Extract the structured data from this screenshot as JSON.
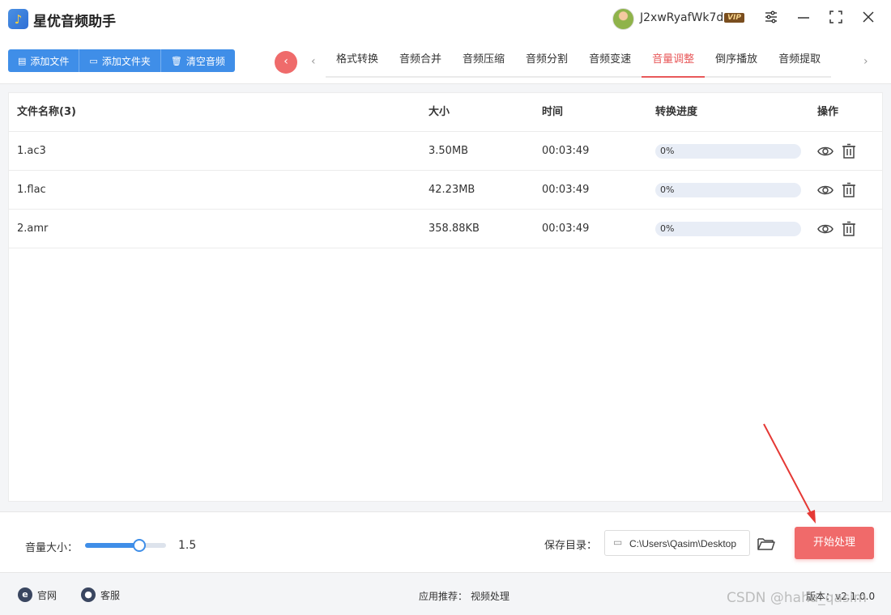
{
  "app": {
    "title": "星优音频助手",
    "logo_icon": "music-note-icon"
  },
  "user": {
    "name": "J2xwRyafWk7d",
    "badge": "VIP"
  },
  "toolbar": {
    "add_file": "添加文件",
    "add_folder": "添加文件夹",
    "clear_audio": "清空音频"
  },
  "tabs": [
    {
      "label": "格式转换",
      "active": false
    },
    {
      "label": "音频合并",
      "active": false
    },
    {
      "label": "音频压缩",
      "active": false
    },
    {
      "label": "音频分割",
      "active": false
    },
    {
      "label": "音频变速",
      "active": false
    },
    {
      "label": "音量调整",
      "active": true
    },
    {
      "label": "倒序播放",
      "active": false
    },
    {
      "label": "音频提取",
      "active": false
    }
  ],
  "table": {
    "headers": {
      "name": "文件名称(3)",
      "size": "大小",
      "time": "时间",
      "progress": "转换进度",
      "ops": "操作"
    },
    "rows": [
      {
        "name": "1.ac3",
        "size": "3.50MB",
        "time": "00:03:49",
        "progress": "0%",
        "progress_value": 0
      },
      {
        "name": "1.flac",
        "size": "42.23MB",
        "time": "00:03:49",
        "progress": "0%",
        "progress_value": 0
      },
      {
        "name": "2.amr",
        "size": "358.88KB",
        "time": "00:03:49",
        "progress": "0%",
        "progress_value": 0
      }
    ]
  },
  "controls": {
    "volume_label": "音量大小：",
    "volume_value": "1.5",
    "volume_fraction": 0.67,
    "save_label": "保存目录：",
    "save_path": "C:\\Users\\Qasim\\Desktop",
    "start_button": "开始处理"
  },
  "footer": {
    "website": "官网",
    "support": "客服",
    "recommend_label": "应用推荐：",
    "recommend_item": "视频处理",
    "version": "版本：v2.1.0.0"
  },
  "watermark": "CSDN @haha_qasim",
  "colors": {
    "accent": "#3f8ee8",
    "primary_red": "#f06a6a",
    "active_tab": "#e8595a"
  }
}
